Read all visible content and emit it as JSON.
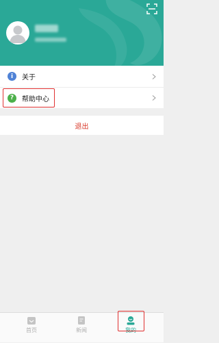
{
  "colors": {
    "brand": "#2aa897",
    "logout": "#d93a2b",
    "highlight": "#e03030"
  },
  "profile": {
    "avatar_icon": "user-avatar-icon",
    "scan_icon": "scan-icon"
  },
  "menu": {
    "items": [
      {
        "label": "关于",
        "icon": "info-icon"
      },
      {
        "label": "帮助中心",
        "icon": "help-icon"
      }
    ]
  },
  "logout": {
    "label": "退出"
  },
  "tabbar": {
    "tabs": [
      {
        "label": "首页",
        "icon": "home-icon"
      },
      {
        "label": "新闻",
        "icon": "news-icon"
      },
      {
        "label": "我的",
        "icon": "profile-icon",
        "active": true
      }
    ]
  }
}
